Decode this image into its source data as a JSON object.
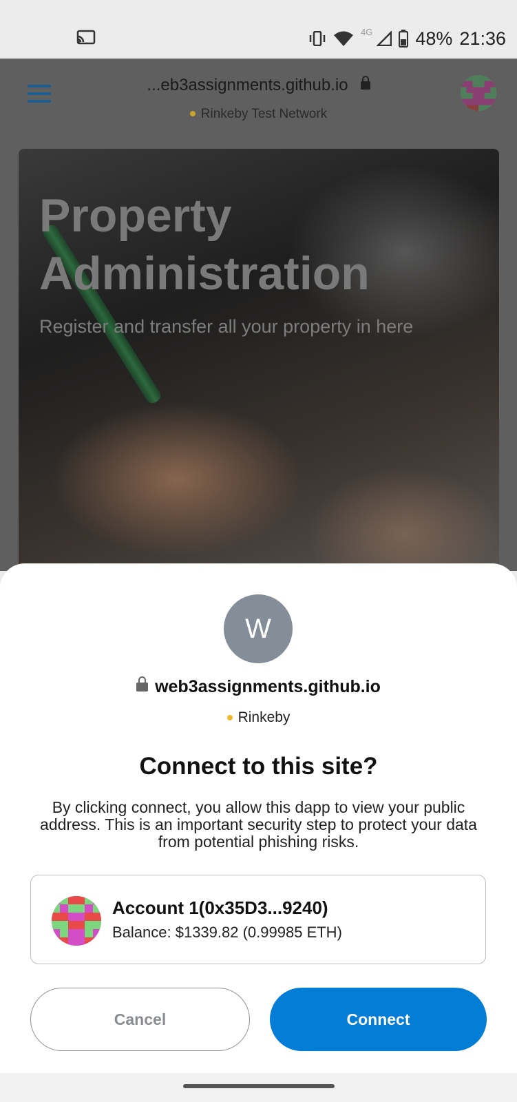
{
  "status_bar": {
    "icons": [
      "cast-icon",
      "vibrate-icon",
      "wifi-icon",
      "signal-icon",
      "battery-icon"
    ],
    "network_type": "4G",
    "battery": "48%",
    "time": "21:36"
  },
  "browser": {
    "url": "...eb3assignments.github.io",
    "network": "Rinkeby Test Network",
    "network_dot_color": "#c9a230"
  },
  "hero": {
    "title_line1": "Property",
    "title_line2": "Administration",
    "subtitle": "Register and transfer all your property in here"
  },
  "connect_dialog": {
    "site_initial": "W",
    "site_name": "web3assignments.github.io",
    "network": "Rinkeby",
    "title": "Connect to this site?",
    "description": "By clicking connect, you allow this dapp to view your public address. This is an important security step to protect your data from potential phishing risks.",
    "account": {
      "name": "Account 1(0x35D3...9240)",
      "balance": "Balance: $1339.82 (0.99985 ETH)"
    },
    "cancel_label": "Cancel",
    "connect_label": "Connect",
    "connect_color": "#037dd6"
  }
}
